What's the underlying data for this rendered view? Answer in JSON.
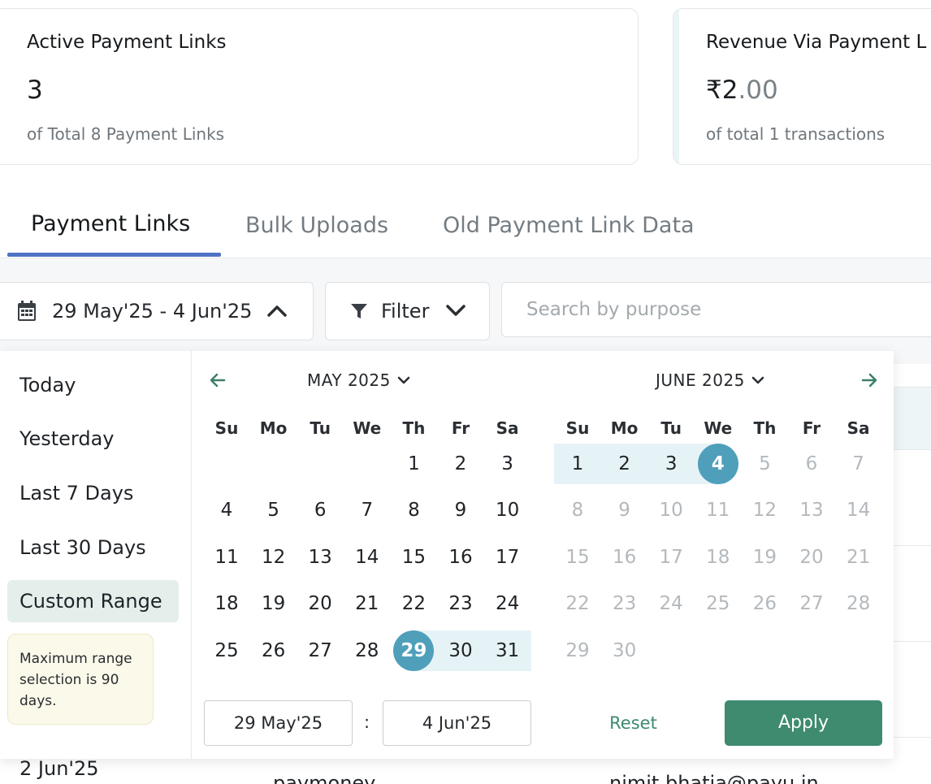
{
  "cards": [
    {
      "title": "Active Payment Links",
      "value_main": "3",
      "value_decimal": "",
      "subtitle": "of Total 8 Payment Links"
    },
    {
      "title": "Revenue Via Payment L",
      "value_main": "₹2",
      "value_decimal": ".00",
      "subtitle": "of total 1 transactions"
    }
  ],
  "tabs": [
    "Payment Links",
    "Bulk Uploads",
    "Old Payment Link Data"
  ],
  "toolbar": {
    "date_range": "29 May'25 - 4 Jun'25",
    "filter_label": "Filter",
    "search_placeholder": "Search by purpose"
  },
  "presets": [
    "Today",
    "Yesterday",
    "Last 7 Days",
    "Last 30 Days",
    "Custom Range"
  ],
  "active_preset": "Custom Range",
  "note": "Maximum range selection is 90 days.",
  "calendar": {
    "left_month": "MAY 2025",
    "right_month": "JUNE 2025",
    "weekdays": [
      "Su",
      "Mo",
      "Tu",
      "We",
      "Th",
      "Fr",
      "Sa"
    ],
    "may_weeks": [
      [
        "",
        "",
        "",
        "",
        "1",
        "2",
        "3"
      ],
      [
        "4",
        "5",
        "6",
        "7",
        "8",
        "9",
        "10"
      ],
      [
        "11",
        "12",
        "13",
        "14",
        "15",
        "16",
        "17"
      ],
      [
        "18",
        "19",
        "20",
        "21",
        "22",
        "23",
        "24"
      ],
      [
        "25",
        "26",
        "27",
        "28",
        "29",
        "30",
        "31"
      ]
    ],
    "june_weeks": [
      [
        "1",
        "2",
        "3",
        "4",
        "5",
        "6",
        "7"
      ],
      [
        "8",
        "9",
        "10",
        "11",
        "12",
        "13",
        "14"
      ],
      [
        "15",
        "16",
        "17",
        "18",
        "19",
        "20",
        "21"
      ],
      [
        "22",
        "23",
        "24",
        "25",
        "26",
        "27",
        "28"
      ],
      [
        "29",
        "30",
        "",
        "",
        "",
        "",
        ""
      ]
    ],
    "range_start": "29 May'25",
    "range_end": "4 Jun'25",
    "start_day": "29",
    "end_day": "4",
    "reset_label": "Reset",
    "apply_label": "Apply",
    "colon": ":"
  },
  "background_rows": {
    "date": "2 Jun'25",
    "name": "paymoney",
    "email": "nimit.bhatia@payu.in"
  },
  "colors": {
    "accent_blue": "#4e73c4",
    "selected_day": "#4f9fbb",
    "range_band": "#e6f3f6",
    "apply_green": "#3e8b6f"
  }
}
